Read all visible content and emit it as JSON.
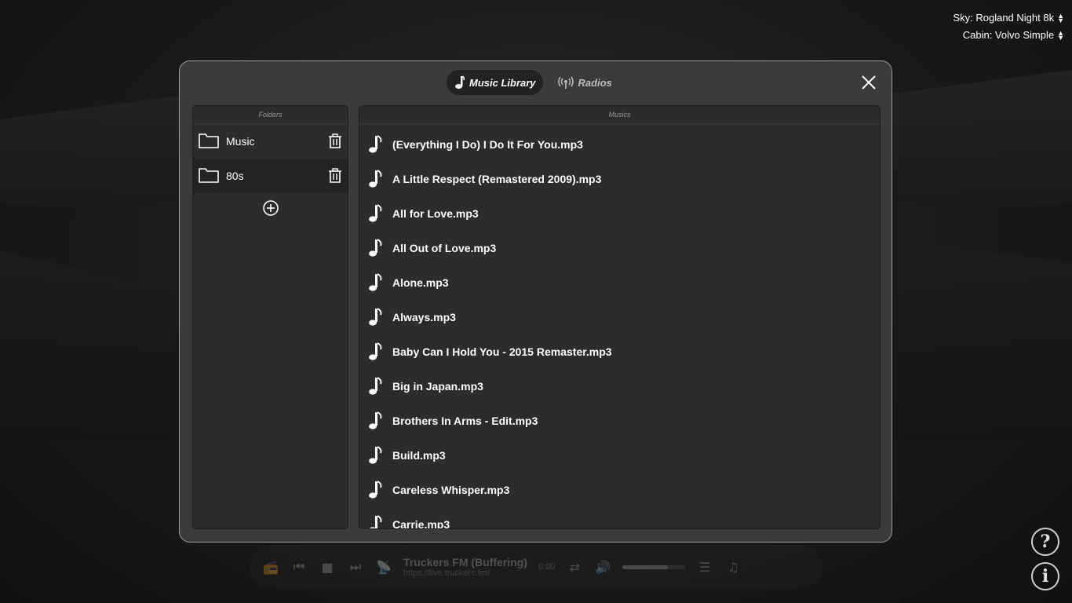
{
  "top_selectors": {
    "sky_label": "Sky: Rogland Night 8k",
    "cabin_label": "Cabin: Volvo Simple"
  },
  "tabs": {
    "music_library": "Music Library",
    "radios": "Radios"
  },
  "folders_panel": {
    "header": "Folders",
    "items": [
      {
        "label": "Music"
      },
      {
        "label": "80s"
      }
    ]
  },
  "musics_panel": {
    "header": "Musics",
    "items": [
      {
        "label": "(Everything I Do) I Do It For You.mp3"
      },
      {
        "label": "A Little Respect (Remastered 2009).mp3"
      },
      {
        "label": "All for Love.mp3"
      },
      {
        "label": "All Out of Love.mp3"
      },
      {
        "label": "Alone.mp3"
      },
      {
        "label": "Always.mp3"
      },
      {
        "label": "Baby Can I Hold You - 2015 Remaster.mp3"
      },
      {
        "label": "Big in Japan.mp3"
      },
      {
        "label": "Brothers In Arms - Edit.mp3"
      },
      {
        "label": "Build.mp3"
      },
      {
        "label": "Careless Whisper.mp3"
      },
      {
        "label": "Carrie.mp3"
      }
    ]
  },
  "player": {
    "station_name": "Truckers FM (Buffering)",
    "station_url": "https://live.truckers.fm/",
    "time": "0:00",
    "volume_fraction": 0.72
  },
  "corner_buttons": {
    "help": "?",
    "info": "i"
  },
  "icons": {
    "tab_music": "music-note-icon",
    "tab_radio": "radio-tower-icon",
    "close": "close-icon",
    "folder": "folder-icon",
    "trash": "trash-icon",
    "add": "plus-circle-icon",
    "note": "music-note-icon"
  }
}
